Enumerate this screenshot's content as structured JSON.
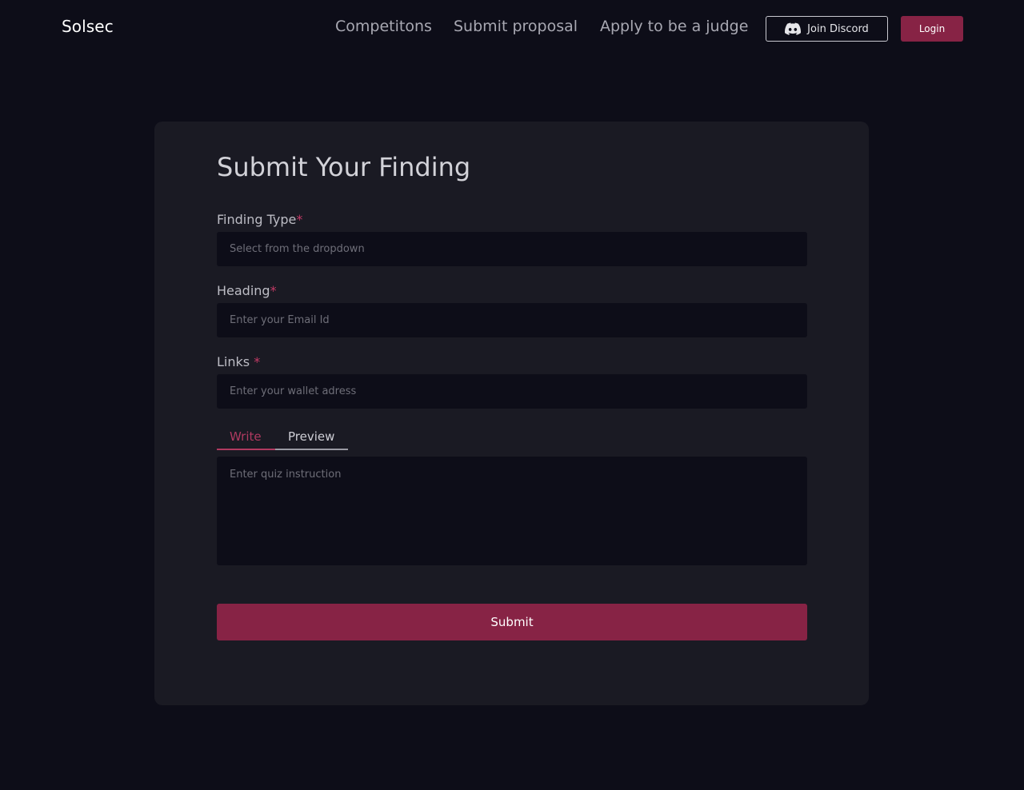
{
  "nav": {
    "brand": "Solsec",
    "links": [
      {
        "label": "Competitons"
      },
      {
        "label": "Submit proposal"
      },
      {
        "label": "Apply to be a judge"
      }
    ],
    "discord_label": "Join Discord",
    "discord_icon": "discord-icon",
    "login_label": "Login"
  },
  "form": {
    "title": "Submit Your Finding",
    "finding_type": {
      "label": "Finding Type",
      "required": "*",
      "placeholder": "Select from the dropdown",
      "value": ""
    },
    "heading": {
      "label": "Heading",
      "required": "*",
      "placeholder": "Enter your Email Id",
      "value": ""
    },
    "links": {
      "label": "Links ",
      "required": "*",
      "placeholder": "Enter your wallet adress",
      "value": ""
    },
    "tabs": {
      "write": "Write",
      "preview": "Preview",
      "active": "Write"
    },
    "instruction": {
      "placeholder": "Enter quiz instruction",
      "value": ""
    },
    "submit_label": "Submit"
  },
  "colors": {
    "background": "#0d0d18",
    "card": "#1a1a23",
    "accent": "#872345",
    "required_mark": "#c43a66"
  }
}
